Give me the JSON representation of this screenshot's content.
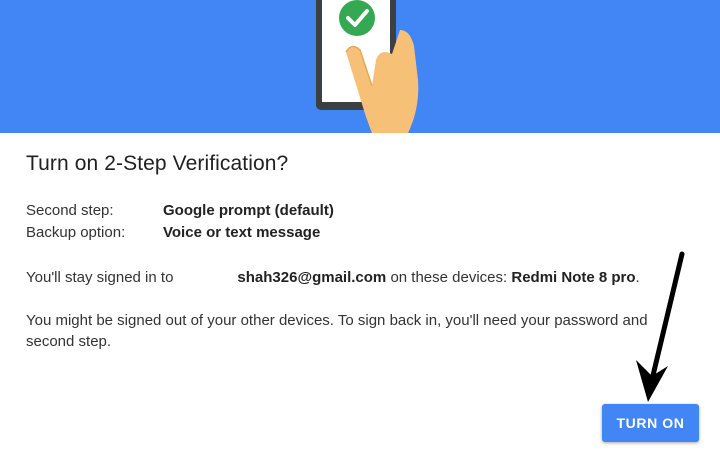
{
  "dialog": {
    "title": "Turn on 2-Step Verification?",
    "second_step_label": "Second step:",
    "second_step_value": "Google prompt (default)",
    "backup_label": "Backup option:",
    "backup_value": "Voice or text message",
    "signed_in_prefix": "You'll stay signed in to",
    "signed_in_email": "shah326@gmail.com",
    "signed_in_middle": " on these devices: ",
    "signed_in_device": "Redmi Note 8 pro",
    "signed_in_suffix": ".",
    "signed_out_notice": "You might be signed out of your other devices. To sign back in, you'll need your password and second step.",
    "turn_on_label": "TURN ON"
  },
  "colors": {
    "banner": "#4285f4",
    "button": "#4285f4",
    "check": "#34a853",
    "hand": "#f6c177"
  },
  "icons": {
    "banner_illustration": "phone-in-hand-illustration",
    "check": "check-circle-icon",
    "annotation": "arrow-annotation"
  }
}
